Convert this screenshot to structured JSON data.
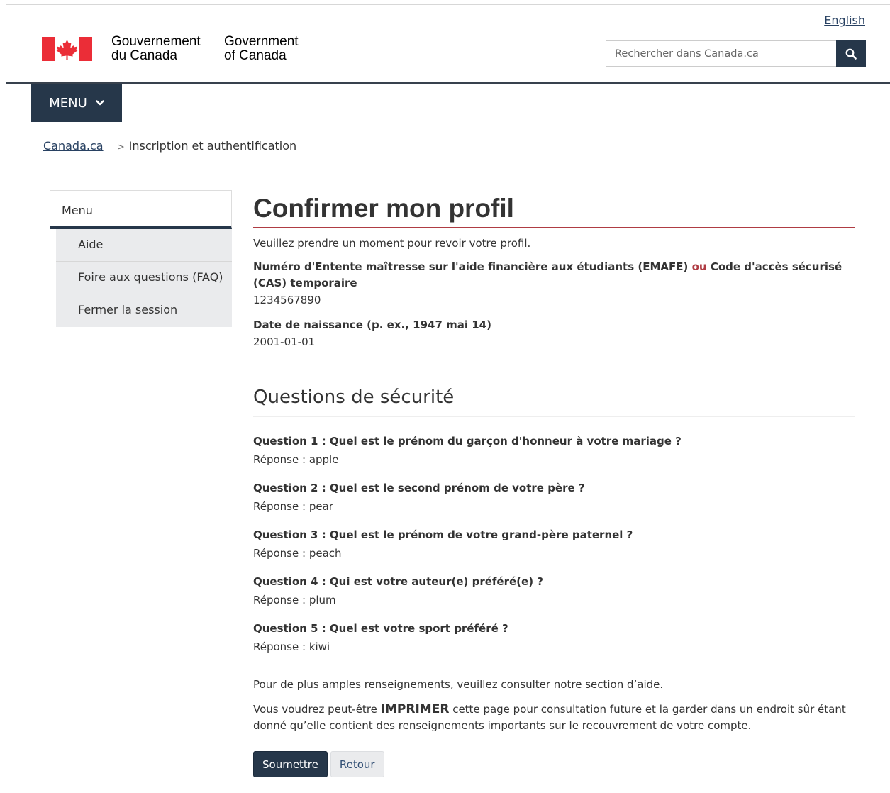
{
  "header": {
    "lang_link": "English",
    "wordmark_fr_line1": "Gouvernement",
    "wordmark_fr_line2": "du Canada",
    "wordmark_en_line1": "Government",
    "wordmark_en_line2": "of Canada",
    "search_placeholder": "Rechercher dans Canada.ca",
    "search_icon": "search-icon",
    "flag_icon": "canada-flag-icon",
    "menu_label": "MENU",
    "menu_icon": "chevron-down-icon"
  },
  "breadcrumb": {
    "home": "Canada.ca",
    "separator": ">",
    "current": "Inscription et authentification"
  },
  "side_menu": {
    "heading": "Menu",
    "items": [
      {
        "label": "Aide"
      },
      {
        "label": "Foire aux questions (FAQ)"
      },
      {
        "label": "Fermer la session"
      }
    ]
  },
  "main": {
    "title": "Confirmer mon profil",
    "intro": "Veuillez prendre un moment pour revoir votre profil.",
    "id_label_part1": "Numéro d'Entente maîtresse sur l'aide financière aux étudiants (EMAFE)",
    "id_label_or": "ou",
    "id_label_part2": "Code d'accès sécurisé (CAS) temporaire",
    "id_value": "1234567890",
    "dob_label": "Date de naissance (p. ex., 1947 mai 14)",
    "dob_value": "2001-01-01",
    "security_heading": "Questions de sécurité",
    "questions": [
      {
        "q": "Question 1 : Quel est le prénom du garçon d'honneur à votre mariage ?",
        "a": "Réponse : apple"
      },
      {
        "q": "Question 2 : Quel est le second prénom de votre père ?",
        "a": "Réponse : pear"
      },
      {
        "q": "Question 3 : Quel est le prénom de votre grand-père paternel ?",
        "a": "Réponse : peach"
      },
      {
        "q": "Question 4 : Qui est votre auteur(e) préféré(e) ?",
        "a": "Réponse : plum"
      },
      {
        "q": "Question 5 : Quel est votre sport préféré ?",
        "a": "Réponse : kiwi"
      }
    ],
    "help_text": "Pour de plus amples renseignements, veuillez consulter notre section d’aide.",
    "print_pre": "Vous voudrez peut-être",
    "print_word": "IMPRIMER",
    "print_post": "cette page pour consultation future et la garder dans un endroit sûr étant donné qu’elle contient des renseignements importants sur le recouvrement de votre compte.",
    "submit_label": "Soumettre",
    "back_label": "Retour"
  },
  "colors": {
    "brand_dark": "#26374a",
    "link": "#284162",
    "accent_red": "#af3c43",
    "flag_red": "#eb2d37"
  }
}
